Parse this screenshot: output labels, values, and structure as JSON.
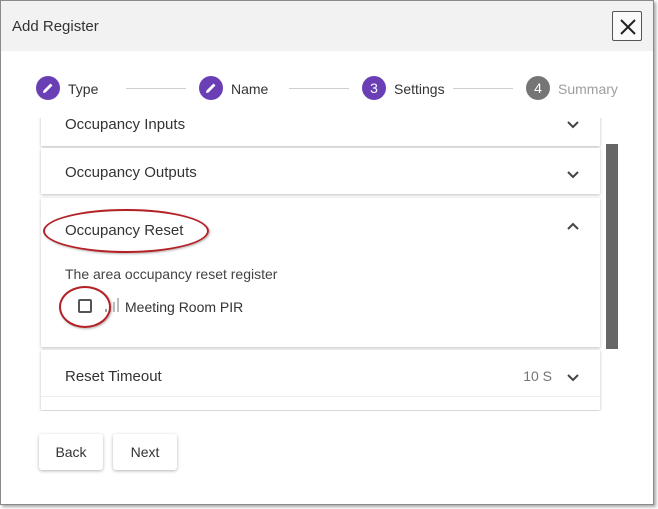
{
  "dialog": {
    "title": "Add Register"
  },
  "stepper": {
    "steps": [
      {
        "number": "",
        "label": "Type",
        "state": "complete"
      },
      {
        "number": "",
        "label": "Name",
        "state": "complete"
      },
      {
        "number": "3",
        "label": "Settings",
        "state": "active"
      },
      {
        "number": "4",
        "label": "Summary",
        "state": "inactive"
      }
    ]
  },
  "panels": {
    "occupancy_inputs": {
      "title": "Occupancy Inputs"
    },
    "occupancy_outputs": {
      "title": "Occupancy Outputs"
    },
    "occupancy_reset": {
      "title": "Occupancy Reset",
      "description": "The area occupancy reset register",
      "option_label": "Meeting Room PIR",
      "option_checked": false
    },
    "reset_timeout": {
      "title": "Reset Timeout",
      "value": "10 S"
    }
  },
  "footer": {
    "back_label": "Back",
    "next_label": "Next"
  },
  "colors": {
    "accent": "#6a3fb5",
    "inactive_step": "#757575",
    "annotation": "#b32025"
  },
  "icons": {
    "close": "close-icon",
    "complete_step": "pencil-icon",
    "expand": "chevron-down-icon",
    "collapse": "chevron-up-icon",
    "signal": "signal-strength-icon"
  }
}
